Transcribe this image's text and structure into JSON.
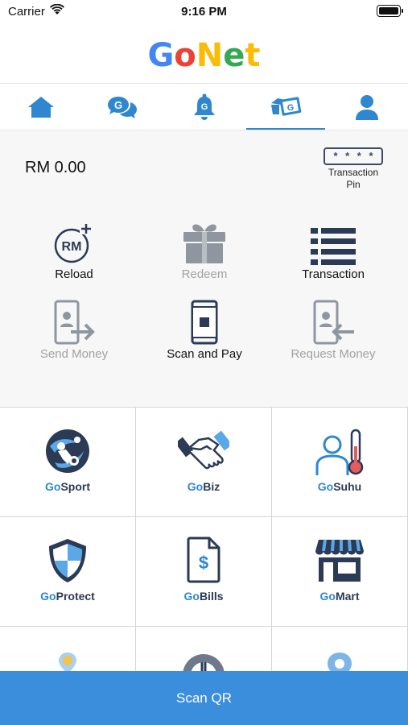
{
  "status_bar": {
    "carrier": "Carrier",
    "time": "9:16 PM"
  },
  "header": {
    "logo_letters": [
      {
        "char": "G",
        "color": "#4285F4"
      },
      {
        "char": "o",
        "color": "#EA4335"
      },
      {
        "char": "N",
        "color": "#FBBC05"
      },
      {
        "char": "e",
        "color": "#34A853"
      },
      {
        "char": "t",
        "color": "#FBBC05"
      }
    ]
  },
  "nav": {
    "items": [
      {
        "icon": "home-icon"
      },
      {
        "icon": "chat-icon"
      },
      {
        "icon": "bell-icon"
      },
      {
        "icon": "wallet-icon",
        "active": true
      },
      {
        "icon": "profile-icon"
      }
    ]
  },
  "wallet": {
    "balance": "RM 0.00",
    "pin_mask": "* * * *",
    "pin_label_1": "Transaction",
    "pin_label_2": "Pin",
    "actions": [
      {
        "label": "Reload",
        "enabled": true
      },
      {
        "label": "Redeem",
        "enabled": false
      },
      {
        "label": "Transaction",
        "enabled": true
      },
      {
        "label": "Send Money",
        "enabled": false
      },
      {
        "label": "Scan and Pay",
        "enabled": true
      },
      {
        "label": "Request Money",
        "enabled": false
      }
    ]
  },
  "services": [
    {
      "prefix": "Go",
      "name": "Sport"
    },
    {
      "prefix": "Go",
      "name": "Biz"
    },
    {
      "prefix": "Go",
      "name": "Suhu"
    },
    {
      "prefix": "Go",
      "name": "Protect"
    },
    {
      "prefix": "Go",
      "name": "Bills"
    },
    {
      "prefix": "Go",
      "name": "Mart"
    }
  ],
  "colors": {
    "accent": "#2f87cf",
    "scan_bar": "#3a8edb",
    "dark_icon": "#2b3a55"
  },
  "scan_button": "Scan QR"
}
